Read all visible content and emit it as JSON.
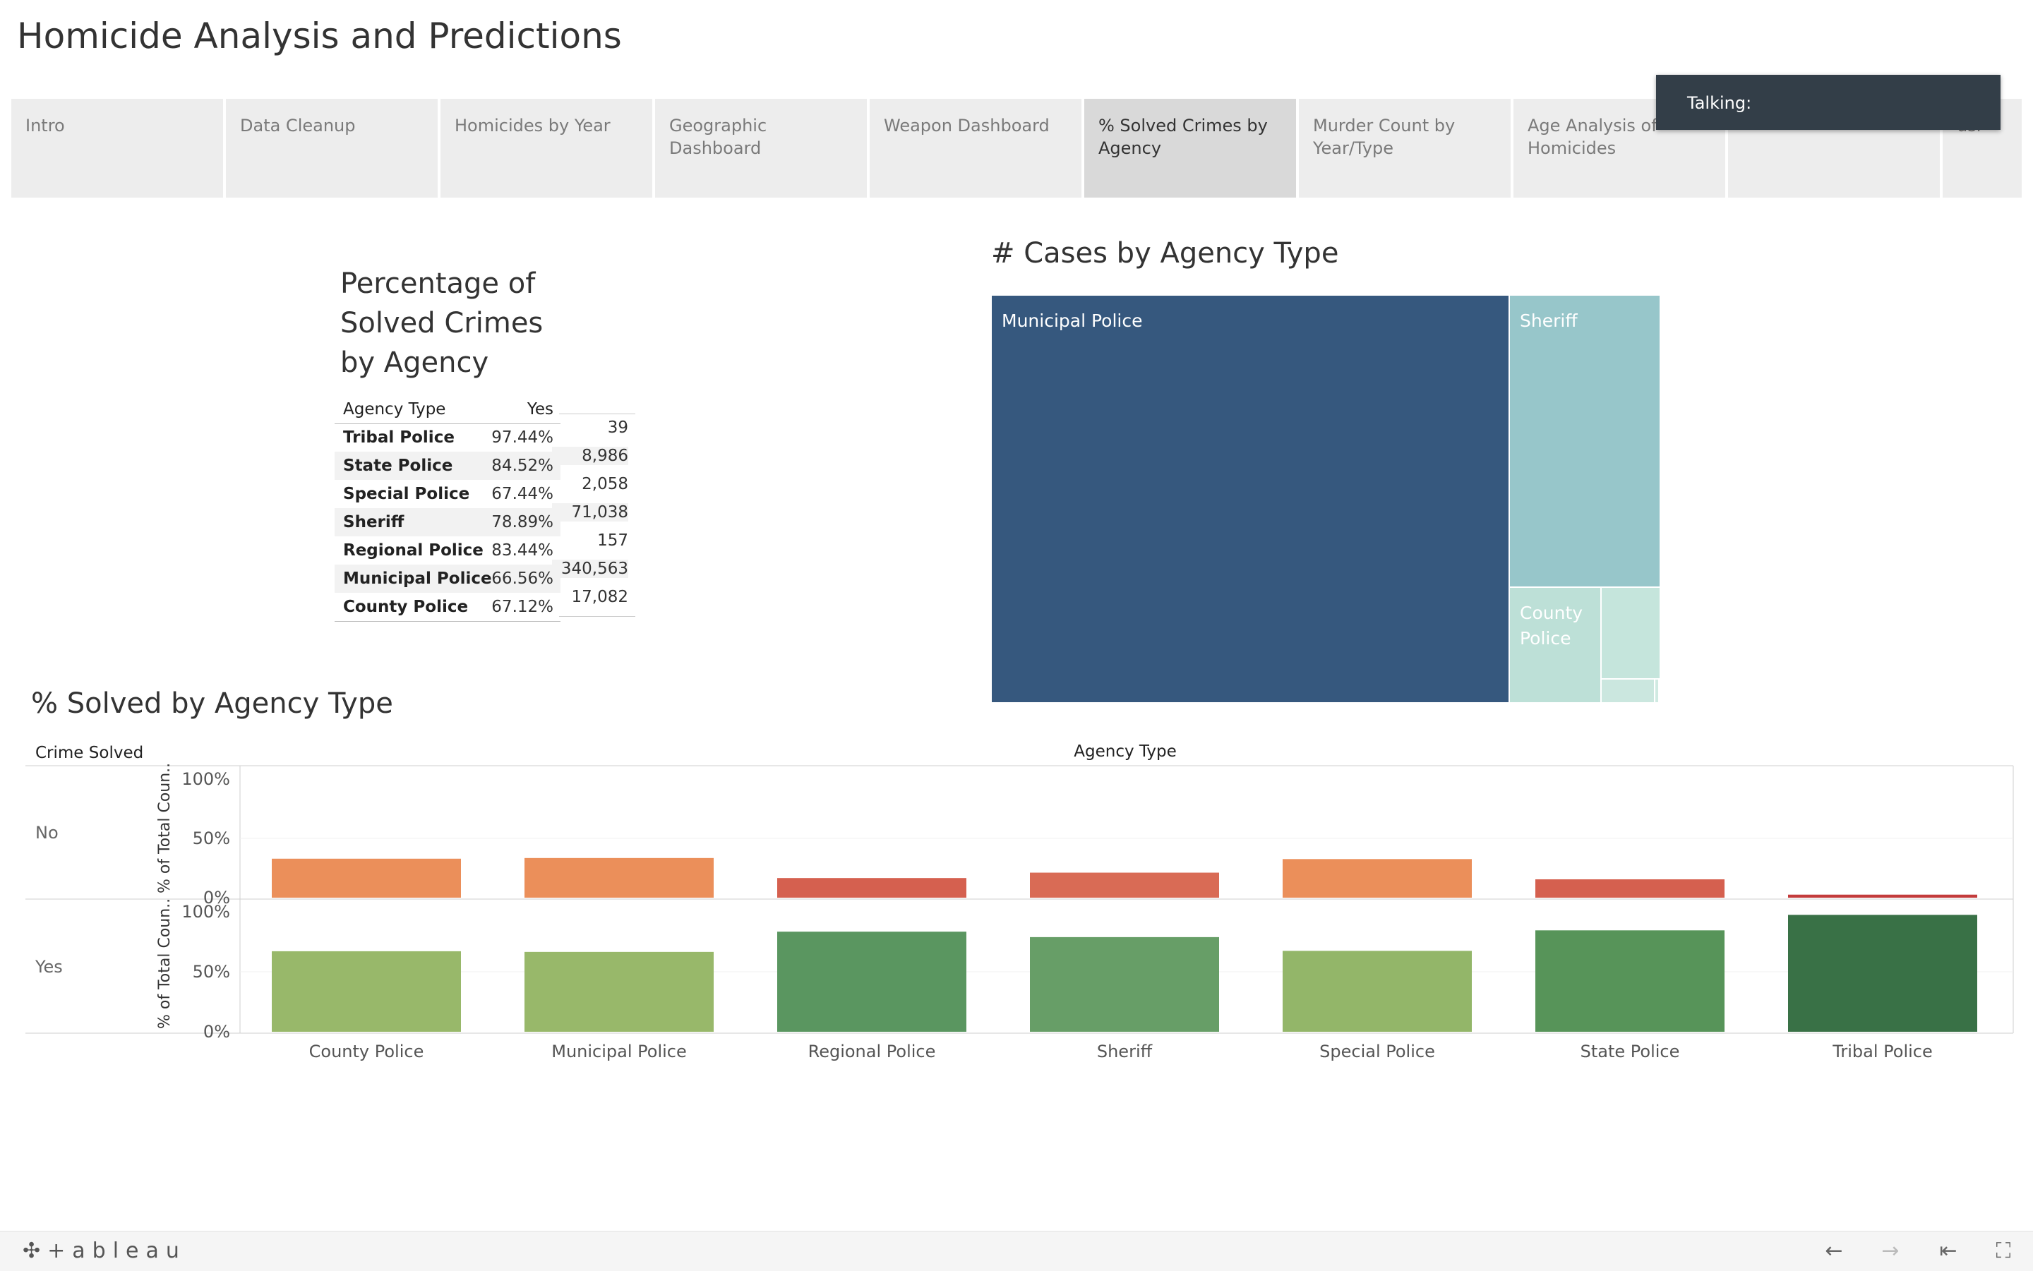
{
  "story": {
    "title": "Homicide Analysis and Predictions",
    "tabs": [
      {
        "label": "Intro"
      },
      {
        "label": "Data Cleanup"
      },
      {
        "label": "Homicides by Year"
      },
      {
        "label": "Geographic Dashboard"
      },
      {
        "label": "Weapon Dashboard"
      },
      {
        "label": "% Solved Crimes by Agency",
        "active": true
      },
      {
        "label": "Murder Count by Year/Type"
      },
      {
        "label": "Age Analysis of Homicides"
      },
      {
        "label": ""
      },
      {
        "label": "usi"
      }
    ]
  },
  "toast": {
    "text": "Talking:"
  },
  "pct_table": {
    "title": "Percentage of Solved Crimes by Agency",
    "col_agency": "Agency Type",
    "col_yes": "Yes",
    "rows": [
      {
        "agency": "Tribal Police",
        "yes": "97.44%",
        "count": "39"
      },
      {
        "agency": "State Police",
        "yes": "84.52%",
        "count": "8,986"
      },
      {
        "agency": "Special Police",
        "yes": "67.44%",
        "count": "2,058"
      },
      {
        "agency": "Sheriff",
        "yes": "78.89%",
        "count": "71,038"
      },
      {
        "agency": "Regional Police",
        "yes": "83.44%",
        "count": "157"
      },
      {
        "agency": "Municipal Police",
        "yes": "66.56%",
        "count": "340,563"
      },
      {
        "agency": "County Police",
        "yes": "67.12%",
        "count": "17,082"
      }
    ]
  },
  "treemap": {
    "title": "# Cases by Agency Type",
    "labels": {
      "municipal": "Municipal Police",
      "sheriff": "Sheriff",
      "county": "County Police"
    }
  },
  "bar_chart": {
    "title": "% Solved by Agency Type",
    "row_header": "Crime Solved",
    "col_header": "Agency Type",
    "axis_label": "% of Total Coun..",
    "row_no": "No",
    "row_yes": "Yes",
    "ticks": [
      "100%",
      "50%",
      "0%"
    ]
  },
  "chart_data": [
    {
      "type": "table",
      "title": "Percentage of Solved Crimes by Agency",
      "columns": [
        "Agency Type",
        "Yes",
        "Count"
      ],
      "rows": [
        [
          "Tribal Police",
          "97.44%",
          "39"
        ],
        [
          "State Police",
          "84.52%",
          "8,986"
        ],
        [
          "Special Police",
          "67.44%",
          "2,058"
        ],
        [
          "Sheriff",
          "78.89%",
          "71,038"
        ],
        [
          "Regional Police",
          "83.44%",
          "157"
        ],
        [
          "Municipal Police",
          "66.56%",
          "340,563"
        ],
        [
          "County Police",
          "67.12%",
          "17,082"
        ]
      ]
    },
    {
      "type": "heatmap",
      "subtype": "treemap",
      "title": "# Cases by Agency Type",
      "categories": [
        "Municipal Police",
        "Sheriff",
        "County Police",
        "State Police",
        "Special Police",
        "Regional Police",
        "Tribal Police"
      ],
      "values": [
        340563,
        71038,
        17082,
        8986,
        2058,
        157,
        39
      ],
      "colors": [
        "#36587e",
        "#97c6ca",
        "#bde0d7",
        "#c5e5dc",
        "#cbe7df",
        "#d0eae2",
        "#d4ece4"
      ]
    },
    {
      "type": "bar",
      "title": "% Solved by Agency Type",
      "xlabel": "Agency Type",
      "ylabel": "% of Total Coun..",
      "ylim": [
        0,
        100
      ],
      "categories": [
        "County Police",
        "Municipal Police",
        "Regional Police",
        "Sheriff",
        "Special Police",
        "State Police",
        "Tribal Police"
      ],
      "series": [
        {
          "name": "No",
          "values": [
            32.88,
            33.44,
            16.56,
            21.11,
            32.56,
            15.48,
            2.56
          ],
          "colors": [
            "#eb8f5a",
            "#eb8f5a",
            "#d5604f",
            "#d96b55",
            "#eb8f5a",
            "#d5604f",
            "#c33b3b"
          ]
        },
        {
          "name": "Yes",
          "values": [
            67.12,
            66.56,
            83.44,
            78.89,
            67.44,
            84.52,
            97.44
          ],
          "colors": [
            "#98b86a",
            "#98b86a",
            "#5a9660",
            "#679e67",
            "#93b669",
            "#579459",
            "#397146"
          ]
        }
      ]
    }
  ]
}
